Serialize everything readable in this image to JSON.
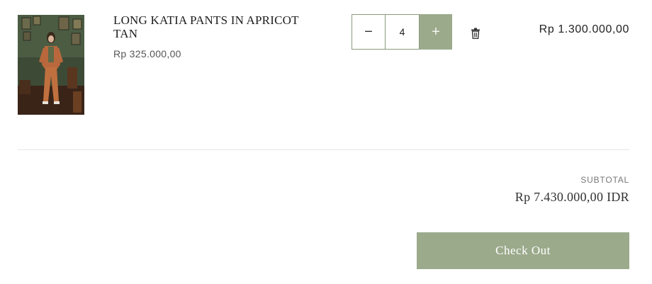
{
  "cart_item": {
    "title": "LONG KATIA PANTS IN APRICOT TAN",
    "unit_price": "Rp 325.000,00",
    "image_alt": "Model wearing apricot tan pants and jacket in a green room",
    "quantity": "4",
    "decrease_symbol": "−",
    "increase_symbol": "+",
    "line_total": "Rp 1.300.000,00",
    "delete_icon": "trash-icon"
  },
  "summary": {
    "subtotal_label": "SUBTOTAL",
    "subtotal_value": "Rp 7.430.000,00 IDR",
    "checkout_label": "Check Out"
  },
  "colors": {
    "accent": "#9caa8c",
    "border": "#8a9a7e",
    "text": "#222222",
    "muted": "#777777"
  }
}
